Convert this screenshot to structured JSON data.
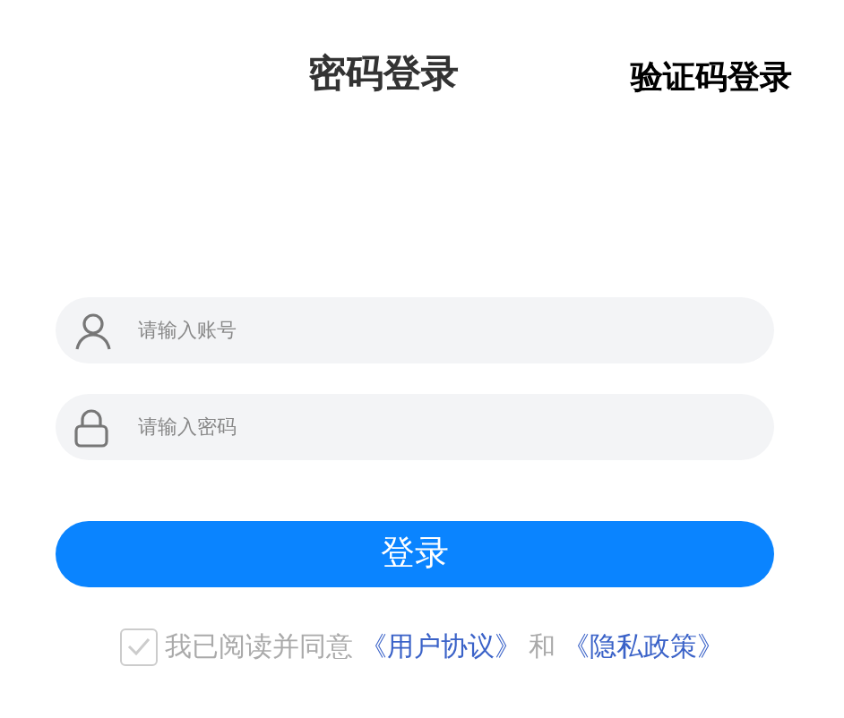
{
  "tabs": [
    {
      "label": "密码登录",
      "selected": true
    },
    {
      "label": "验证码登录",
      "selected": false
    }
  ],
  "fields": [
    {
      "kind": "account",
      "placeholder": "请输入账号"
    },
    {
      "kind": "password",
      "placeholder": "请输入密码"
    }
  ],
  "login_button": "登录",
  "agreement": {
    "checked": false,
    "text": "我已阅读并同意",
    "link_1": "《用户协议》",
    "joiner": "和",
    "link_2": "《隐私政策》"
  }
}
